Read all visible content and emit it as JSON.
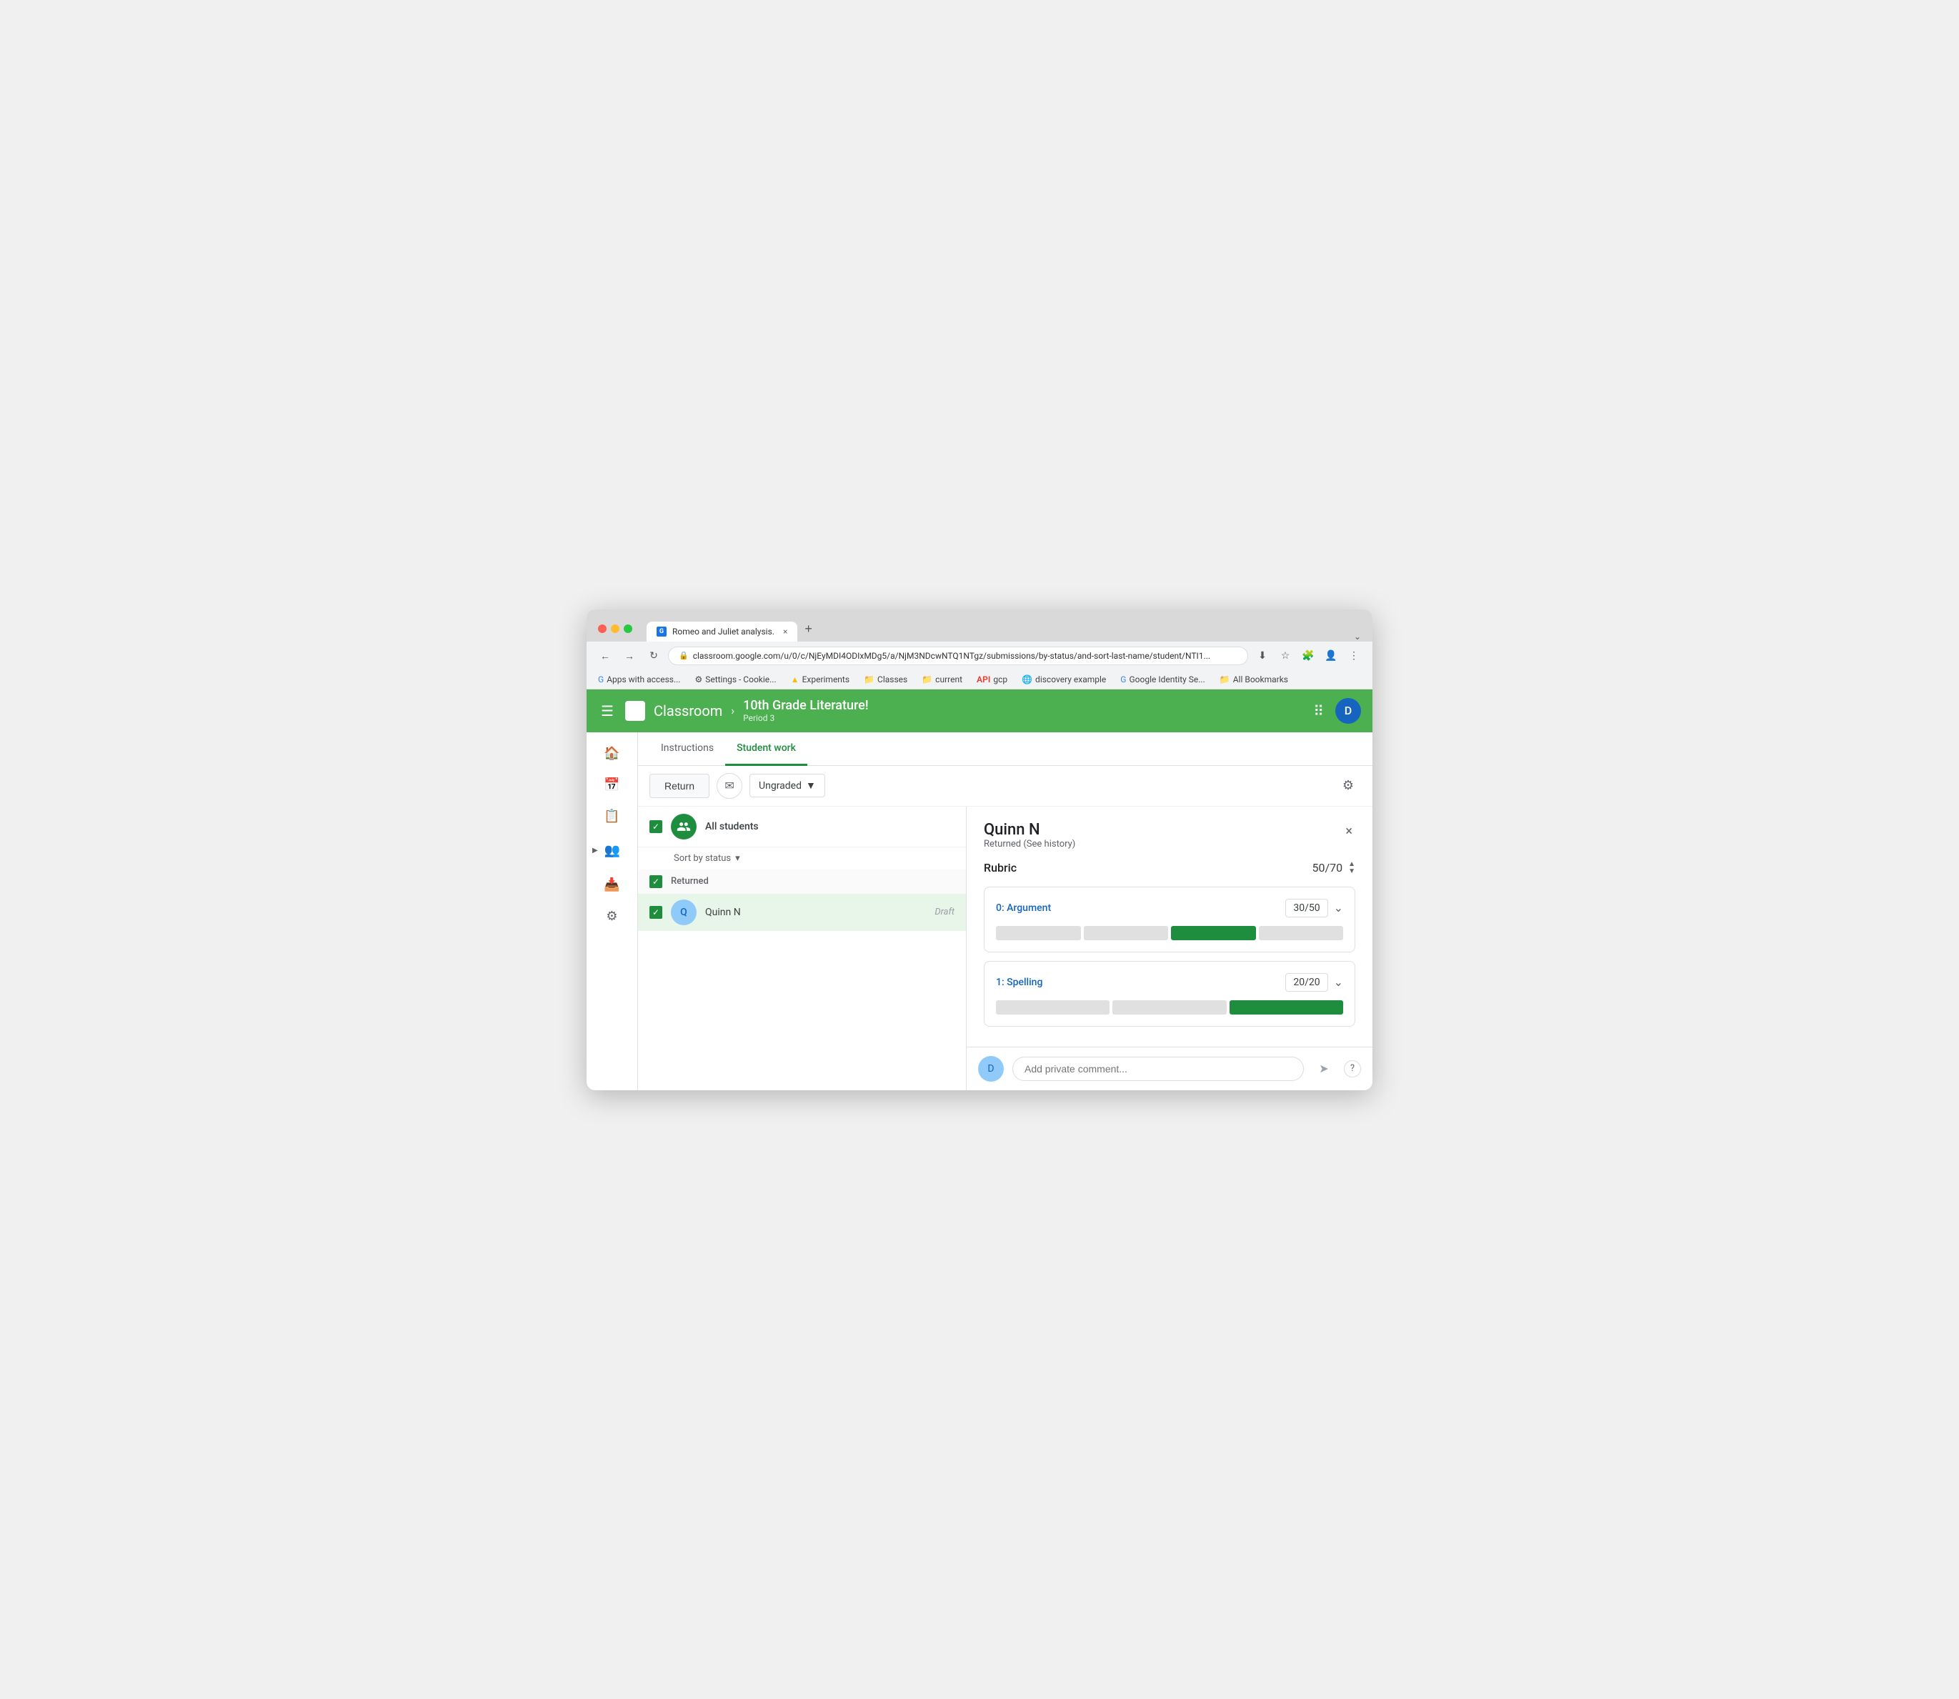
{
  "browser": {
    "tab_title": "Romeo and Juliet analysis.",
    "tab_close": "×",
    "tab_new": "+",
    "nav_back": "←",
    "nav_forward": "→",
    "nav_refresh": "↻",
    "address_url": "classroom.google.com/u/0/c/NjEyMDI4ODIxMDg5/a/NjM3NDcwNTQ1NTgz/submissions/by-status/and-sort-last-name/student/NTI1...",
    "bookmarks": [
      {
        "label": "Apps with access...",
        "color": "#4285F4"
      },
      {
        "label": "Settings - Cookie...",
        "color": "#fbbc04"
      },
      {
        "label": "Experiments",
        "color": "#34a853"
      },
      {
        "label": "Classes",
        "color": "#fbbc04"
      },
      {
        "label": "current",
        "color": "#5f6368"
      },
      {
        "label": "gcp",
        "color": "#ea4335"
      },
      {
        "label": "discovery example",
        "color": "#4285F4"
      },
      {
        "label": "Google Identity Se...",
        "color": "#4285F4"
      },
      {
        "label": "All Bookmarks",
        "color": "#5f6368"
      }
    ]
  },
  "app": {
    "title": "Classroom",
    "course_name": "10th Grade Literature!",
    "course_period": "Period 3",
    "user_initial": "D"
  },
  "tabs": {
    "instructions_label": "Instructions",
    "student_work_label": "Student work"
  },
  "toolbar": {
    "return_label": "Return",
    "status_label": "Ungraded",
    "mail_icon": "✉",
    "dropdown_arrow": "▼",
    "settings_icon": "⚙"
  },
  "student_list": {
    "all_students_label": "All students",
    "sort_label": "Sort by status",
    "sort_arrow": "▾",
    "section_label": "Returned",
    "student": {
      "name": "Quinn N",
      "status": "Draft"
    }
  },
  "detail": {
    "student_name": "Quinn N",
    "student_status": "Returned (See history)",
    "rubric_title": "Rubric",
    "rubric_score": "50/70",
    "close_btn": "×",
    "criteria": [
      {
        "title": "0: Argument",
        "score": "30/50",
        "segments": [
          "empty",
          "empty",
          "selected",
          "empty"
        ]
      },
      {
        "title": "1: Spelling",
        "score": "20/20",
        "segments": [
          "empty",
          "empty",
          "selected"
        ]
      }
    ],
    "comment_placeholder": "Add private comment...",
    "send_icon": "➤",
    "help_icon": "?"
  }
}
